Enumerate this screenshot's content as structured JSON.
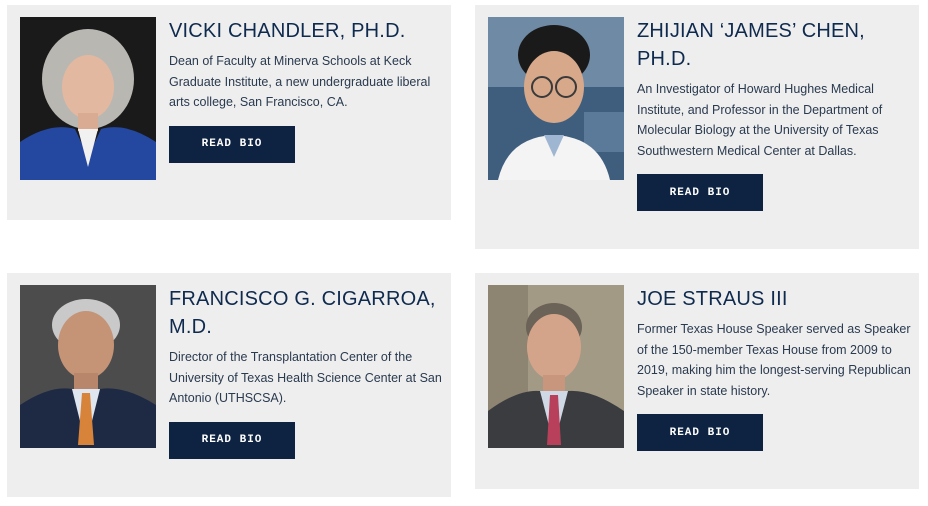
{
  "people": [
    {
      "name": "VICKI CHANDLER, PH.D.",
      "description": "Dean of Faculty at Minerva Schools at Keck Graduate Institute, a new undergraduate liberal arts college, San Francisco, CA.",
      "button_label": "READ BIO",
      "photo_icon": "portrait-vicki-chandler"
    },
    {
      "name": "ZHIJIAN ‘JAMES’ CHEN, PH.D.",
      "description": "An Investigator of Howard Hughes Medical Institute, and Professor in the Department of Molecular Biology at the University of Texas Southwestern Medical Center at Dallas.",
      "button_label": "READ BIO",
      "photo_icon": "portrait-zhijian-chen"
    },
    {
      "name": "FRANCISCO G. CIGARROA, M.D.",
      "description": "Director of the Transplantation Center of the University of Texas Health Science Center at San Antonio (UTHSCSA).",
      "button_label": "READ BIO",
      "photo_icon": "portrait-francisco-cigarroa"
    },
    {
      "name": "JOE STRAUS III",
      "description": "Former Texas House Speaker served as Speaker of the 150-member Texas House from 2009 to 2019, making him the longest-serving Republican Speaker in state history.",
      "button_label": "READ BIO",
      "photo_icon": "portrait-joe-straus"
    }
  ],
  "colors": {
    "card_background": "#eeeeee",
    "heading": "#0f2a4f",
    "button": "#0d2341",
    "button_text": "#ffffff"
  }
}
